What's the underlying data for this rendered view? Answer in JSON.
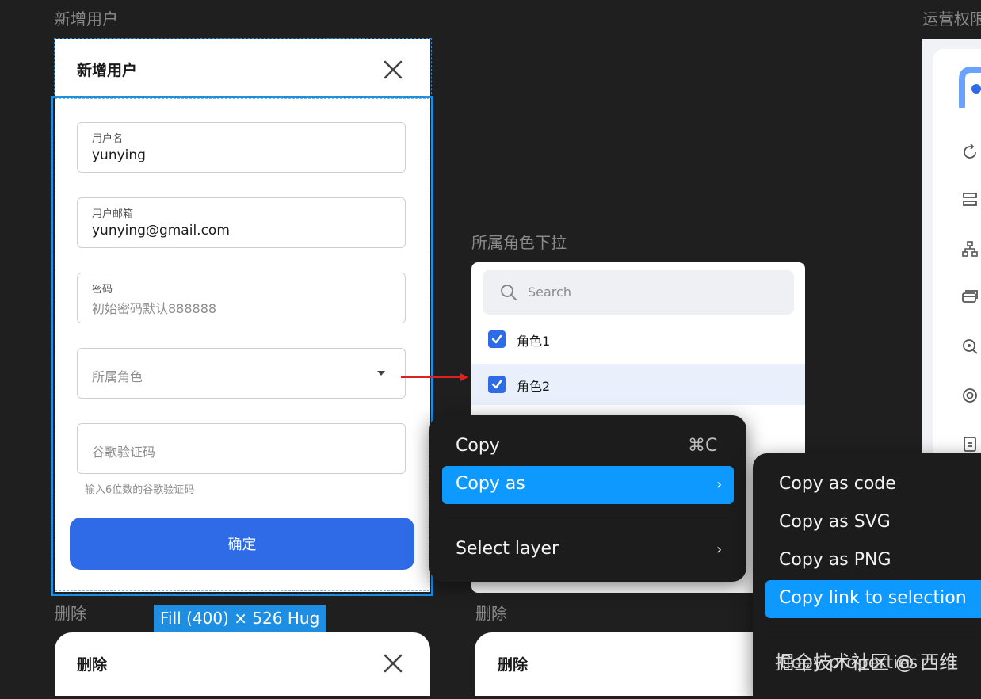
{
  "frame_labels": {
    "add_user": "新增用户",
    "role_dropdown": "所属角色下拉",
    "ops_permission": "运营权限",
    "delete_left": "删除",
    "delete_right": "删除"
  },
  "add_user_dialog": {
    "title": "新增用户",
    "fields": {
      "username": {
        "label": "用户名",
        "value": "yunying"
      },
      "email": {
        "label": "用户邮箱",
        "value": "yunying@gmail.com"
      },
      "password": {
        "label": "密码",
        "placeholder": "初始密码默认888888"
      },
      "role": {
        "placeholder": "所属角色"
      },
      "google_code": {
        "placeholder": "谷歌验证码",
        "hint": "输入6位数的谷歌验证码"
      }
    },
    "submit_label": "确定",
    "size_badge": "Fill (400) × 526 Hug"
  },
  "role_dropdown": {
    "search_placeholder": "Search",
    "options": [
      {
        "label": "角色1",
        "checked": true
      },
      {
        "label": "角色2",
        "checked": true
      }
    ]
  },
  "context_menu": {
    "items": [
      {
        "label": "Copy",
        "shortcut": "⌘C"
      },
      {
        "label": "Copy as",
        "highlighted": true
      },
      {
        "label": "Select layer"
      }
    ]
  },
  "copy_as_submenu": {
    "items": [
      {
        "label": "Copy as code"
      },
      {
        "label": "Copy as SVG"
      },
      {
        "label": "Copy as PNG"
      },
      {
        "label": "Copy link to selection",
        "highlighted": true
      },
      {
        "label": "Copy properties"
      }
    ]
  },
  "delete_dialogs": {
    "left_title": "删除",
    "right_title": "删除"
  },
  "watermark": "掘金技术社区 @ 西维",
  "colors": {
    "canvas": "#1f1f1f",
    "primary": "#2f6be6",
    "selection": "#1e8ee3",
    "menu_highlight": "#0d99ff",
    "arrow": "#e02020"
  }
}
